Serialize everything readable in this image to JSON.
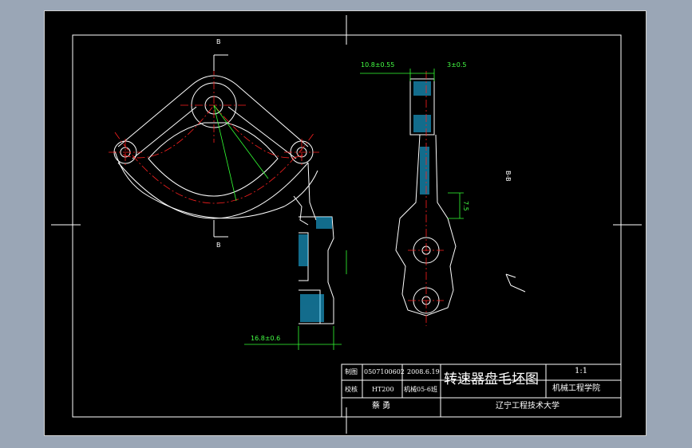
{
  "colors": {
    "background": "#9aa6b6",
    "paper": "#000000",
    "line": "#ffffff",
    "centerline": "#ff2020",
    "dimension": "#33ff33",
    "hatch": "#22c5ff"
  },
  "section_labels": {
    "b_top": "B",
    "b_bottom": "B",
    "b_view": "B-B"
  },
  "dimensions": {
    "width_top": "10.8±0.55",
    "offset_top": "3±0.5",
    "width_bottom": "16.8±0.6",
    "vert_small": "7.5"
  },
  "title_block": {
    "draw_label": "制图",
    "draw_id": "0507100602",
    "date": "2008.6.19",
    "check_label": "校核",
    "material": "HT200",
    "class": "机械05-6班",
    "title": "转速器盘毛坯图",
    "scale": "1:1",
    "dept": "机械工程学院",
    "author": "蔡 勇",
    "school": "辽宁工程技术大学"
  }
}
